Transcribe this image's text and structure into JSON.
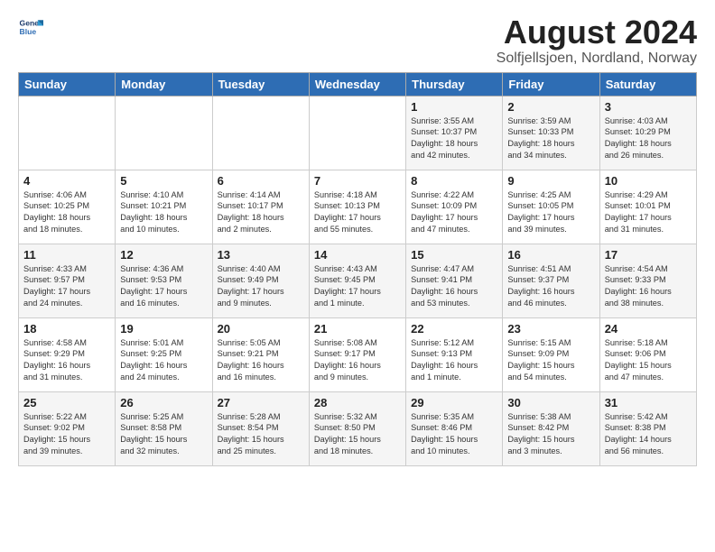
{
  "logo": {
    "line1": "General",
    "line2": "Blue"
  },
  "title": "August 2024",
  "subtitle": "Solfjellsjoen, Nordland, Norway",
  "days_of_week": [
    "Sunday",
    "Monday",
    "Tuesday",
    "Wednesday",
    "Thursday",
    "Friday",
    "Saturday"
  ],
  "weeks": [
    [
      {
        "day": "",
        "info": ""
      },
      {
        "day": "",
        "info": ""
      },
      {
        "day": "",
        "info": ""
      },
      {
        "day": "",
        "info": ""
      },
      {
        "day": "1",
        "info": "Sunrise: 3:55 AM\nSunset: 10:37 PM\nDaylight: 18 hours\nand 42 minutes."
      },
      {
        "day": "2",
        "info": "Sunrise: 3:59 AM\nSunset: 10:33 PM\nDaylight: 18 hours\nand 34 minutes."
      },
      {
        "day": "3",
        "info": "Sunrise: 4:03 AM\nSunset: 10:29 PM\nDaylight: 18 hours\nand 26 minutes."
      }
    ],
    [
      {
        "day": "4",
        "info": "Sunrise: 4:06 AM\nSunset: 10:25 PM\nDaylight: 18 hours\nand 18 minutes."
      },
      {
        "day": "5",
        "info": "Sunrise: 4:10 AM\nSunset: 10:21 PM\nDaylight: 18 hours\nand 10 minutes."
      },
      {
        "day": "6",
        "info": "Sunrise: 4:14 AM\nSunset: 10:17 PM\nDaylight: 18 hours\nand 2 minutes."
      },
      {
        "day": "7",
        "info": "Sunrise: 4:18 AM\nSunset: 10:13 PM\nDaylight: 17 hours\nand 55 minutes."
      },
      {
        "day": "8",
        "info": "Sunrise: 4:22 AM\nSunset: 10:09 PM\nDaylight: 17 hours\nand 47 minutes."
      },
      {
        "day": "9",
        "info": "Sunrise: 4:25 AM\nSunset: 10:05 PM\nDaylight: 17 hours\nand 39 minutes."
      },
      {
        "day": "10",
        "info": "Sunrise: 4:29 AM\nSunset: 10:01 PM\nDaylight: 17 hours\nand 31 minutes."
      }
    ],
    [
      {
        "day": "11",
        "info": "Sunrise: 4:33 AM\nSunset: 9:57 PM\nDaylight: 17 hours\nand 24 minutes."
      },
      {
        "day": "12",
        "info": "Sunrise: 4:36 AM\nSunset: 9:53 PM\nDaylight: 17 hours\nand 16 minutes."
      },
      {
        "day": "13",
        "info": "Sunrise: 4:40 AM\nSunset: 9:49 PM\nDaylight: 17 hours\nand 9 minutes."
      },
      {
        "day": "14",
        "info": "Sunrise: 4:43 AM\nSunset: 9:45 PM\nDaylight: 17 hours\nand 1 minute."
      },
      {
        "day": "15",
        "info": "Sunrise: 4:47 AM\nSunset: 9:41 PM\nDaylight: 16 hours\nand 53 minutes."
      },
      {
        "day": "16",
        "info": "Sunrise: 4:51 AM\nSunset: 9:37 PM\nDaylight: 16 hours\nand 46 minutes."
      },
      {
        "day": "17",
        "info": "Sunrise: 4:54 AM\nSunset: 9:33 PM\nDaylight: 16 hours\nand 38 minutes."
      }
    ],
    [
      {
        "day": "18",
        "info": "Sunrise: 4:58 AM\nSunset: 9:29 PM\nDaylight: 16 hours\nand 31 minutes."
      },
      {
        "day": "19",
        "info": "Sunrise: 5:01 AM\nSunset: 9:25 PM\nDaylight: 16 hours\nand 24 minutes."
      },
      {
        "day": "20",
        "info": "Sunrise: 5:05 AM\nSunset: 9:21 PM\nDaylight: 16 hours\nand 16 minutes."
      },
      {
        "day": "21",
        "info": "Sunrise: 5:08 AM\nSunset: 9:17 PM\nDaylight: 16 hours\nand 9 minutes."
      },
      {
        "day": "22",
        "info": "Sunrise: 5:12 AM\nSunset: 9:13 PM\nDaylight: 16 hours\nand 1 minute."
      },
      {
        "day": "23",
        "info": "Sunrise: 5:15 AM\nSunset: 9:09 PM\nDaylight: 15 hours\nand 54 minutes."
      },
      {
        "day": "24",
        "info": "Sunrise: 5:18 AM\nSunset: 9:06 PM\nDaylight: 15 hours\nand 47 minutes."
      }
    ],
    [
      {
        "day": "25",
        "info": "Sunrise: 5:22 AM\nSunset: 9:02 PM\nDaylight: 15 hours\nand 39 minutes."
      },
      {
        "day": "26",
        "info": "Sunrise: 5:25 AM\nSunset: 8:58 PM\nDaylight: 15 hours\nand 32 minutes."
      },
      {
        "day": "27",
        "info": "Sunrise: 5:28 AM\nSunset: 8:54 PM\nDaylight: 15 hours\nand 25 minutes."
      },
      {
        "day": "28",
        "info": "Sunrise: 5:32 AM\nSunset: 8:50 PM\nDaylight: 15 hours\nand 18 minutes."
      },
      {
        "day": "29",
        "info": "Sunrise: 5:35 AM\nSunset: 8:46 PM\nDaylight: 15 hours\nand 10 minutes."
      },
      {
        "day": "30",
        "info": "Sunrise: 5:38 AM\nSunset: 8:42 PM\nDaylight: 15 hours\nand 3 minutes."
      },
      {
        "day": "31",
        "info": "Sunrise: 5:42 AM\nSunset: 8:38 PM\nDaylight: 14 hours\nand 56 minutes."
      }
    ]
  ]
}
